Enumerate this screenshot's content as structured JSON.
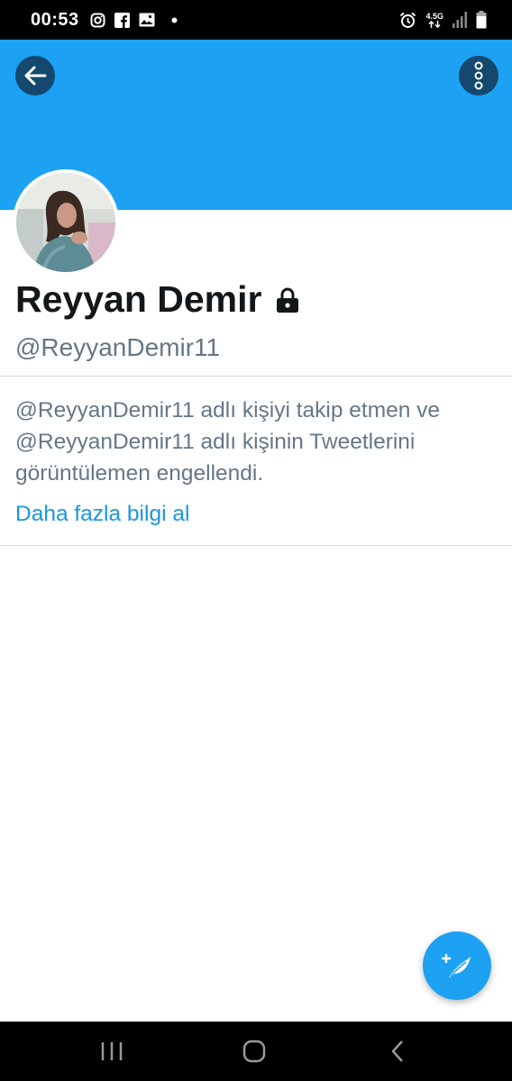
{
  "status_bar": {
    "time": "00:53",
    "left_icons": [
      "instagram-icon",
      "facebook-icon",
      "gallery-icon",
      "dot-icon"
    ],
    "network": "4.5G",
    "right_icons": [
      "alarm-icon",
      "network-icon",
      "signal-icon",
      "battery-icon"
    ]
  },
  "header": {
    "banner_color": "#1da1f2",
    "back_icon": "arrow-left-icon",
    "more_icon": "more-vertical-icon"
  },
  "profile": {
    "name": "Reyyan Demir",
    "protected_icon": "lock-icon",
    "handle": "@ReyyanDemir11"
  },
  "blocked_notice": {
    "message": "@ReyyanDemir11 adlı kişiyi takip etmen ve @ReyyanDemir11 adlı kişinin Tweetlerini görüntülemen engellendi.",
    "learn_more": "Daha fazla bilgi al"
  },
  "fab": {
    "icon": "compose-tweet-icon"
  },
  "nav_bar": {
    "icons": [
      "recent-apps-icon",
      "home-icon",
      "back-icon"
    ]
  },
  "colors": {
    "accent": "#1da1f2",
    "link": "#1b95e0",
    "secondary_text": "#657786",
    "primary_text": "#14171a"
  }
}
